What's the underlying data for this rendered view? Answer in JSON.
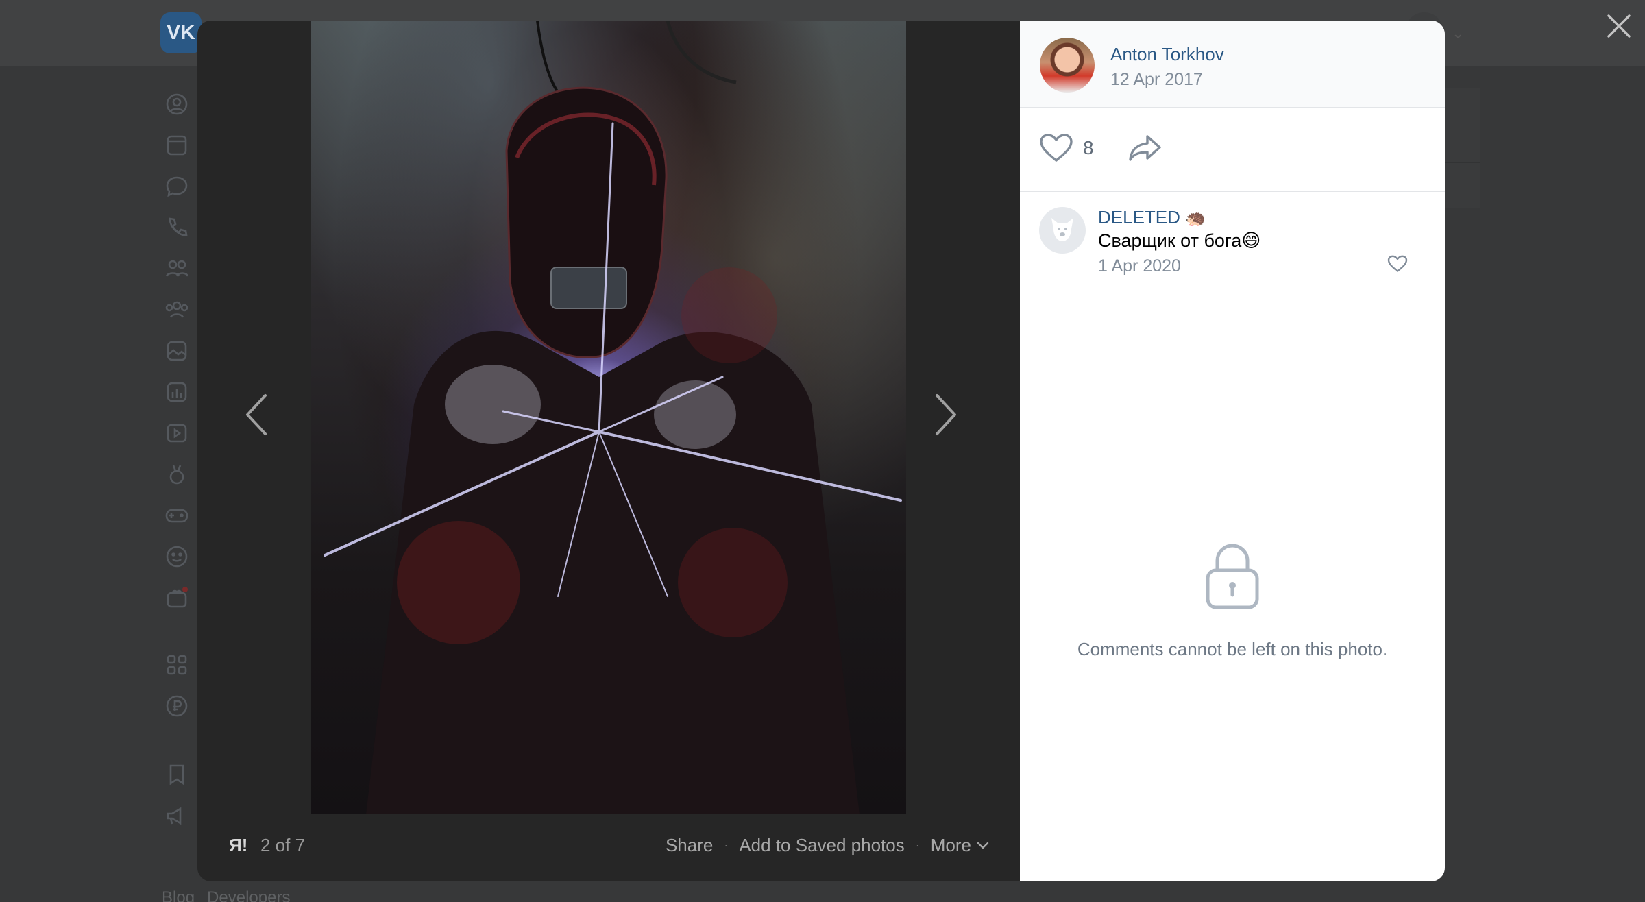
{
  "background": {
    "logo": "VK",
    "footer_links": [
      "Blog",
      "Developers"
    ]
  },
  "viewer": {
    "album": "Я!",
    "counter": "2 of 7",
    "actions": {
      "share": "Share",
      "save": "Add to Saved photos",
      "more": "More"
    }
  },
  "post": {
    "author": "Anton Torkhov",
    "date": "12 Apr 2017",
    "likes": "8"
  },
  "comment": {
    "author": "DELETED",
    "author_emoji": "🦔",
    "text": "Сварщик от бога😄",
    "date": "1 Apr 2020"
  },
  "comments_locked": {
    "message": "Comments cannot be left on this photo."
  },
  "colors": {
    "accent": "#2a5885",
    "muted": "#818c99",
    "overlay": "#373839"
  }
}
